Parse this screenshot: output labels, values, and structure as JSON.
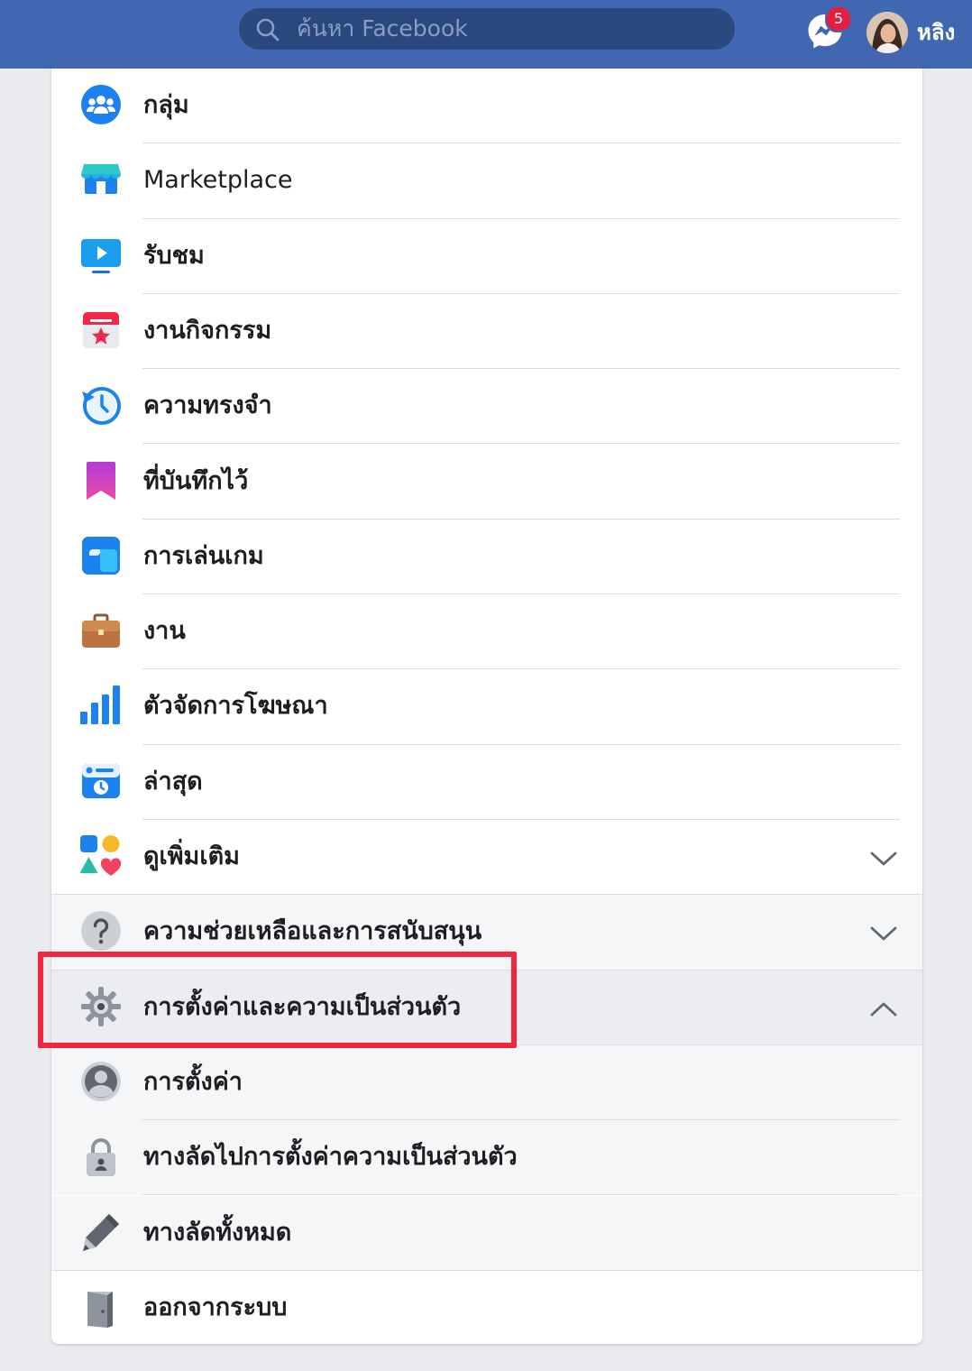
{
  "header": {
    "search_placeholder": "ค้นหา Facebook",
    "messenger_badge": "5",
    "user_name": "หลิง"
  },
  "menu": {
    "items": [
      {
        "label": "กลุ่ม",
        "icon": "groups-icon"
      },
      {
        "label": "Marketplace",
        "icon": "marketplace-icon"
      },
      {
        "label": "รับชม",
        "icon": "watch-icon"
      },
      {
        "label": "งานกิจกรรม",
        "icon": "events-icon"
      },
      {
        "label": "ความทรงจำ",
        "icon": "memories-icon"
      },
      {
        "label": "ที่บันทึกไว้",
        "icon": "saved-icon"
      },
      {
        "label": "การเล่นเกม",
        "icon": "gaming-icon"
      },
      {
        "label": "งาน",
        "icon": "jobs-icon"
      },
      {
        "label": "ตัวจัดการโฆษณา",
        "icon": "ads-manager-icon"
      },
      {
        "label": "ล่าสุด",
        "icon": "most-recent-icon"
      },
      {
        "label": "ดูเพิ่มเติม",
        "icon": "see-more-icon"
      }
    ],
    "help": {
      "label": "ความช่วยเหลือและการสนับสนุน",
      "icon": "help-icon"
    },
    "settings_privacy": {
      "label": "การตั้งค่าและความเป็นส่วนตัว",
      "icon": "gear-icon",
      "expanded": true
    },
    "sub_items": [
      {
        "label": "การตั้งค่า",
        "icon": "account-icon"
      },
      {
        "label": "ทางลัดไปการตั้งค่าความเป็นส่วนตัว",
        "icon": "lock-icon"
      },
      {
        "label": "ทางลัดทั้งหมด",
        "icon": "pencil-icon"
      }
    ],
    "logout": {
      "label": "ออกจากระบบ",
      "icon": "logout-door-icon"
    }
  },
  "colors": {
    "header_bg": "#4267b2",
    "highlight": "#f0263e",
    "badge": "#e41e3f"
  }
}
